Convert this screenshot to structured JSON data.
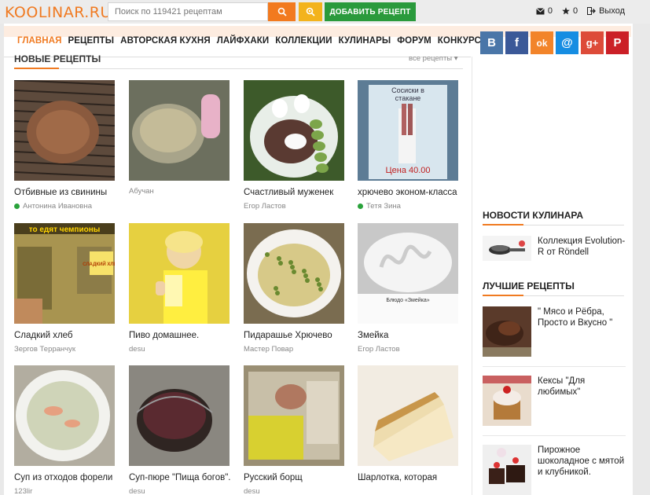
{
  "header": {
    "logo": "KOOLINAR.RU",
    "search_placeholder": "Поиск по 119421 рецептам",
    "add_recipe": "ДОБАВИТЬ РЕЦЕПТ",
    "messages_count": "0",
    "favorites_count": "0",
    "logout": "Выход"
  },
  "nav": [
    "ГЛАВНАЯ",
    "РЕЦЕПТЫ",
    "АВТОРСКАЯ КУХНЯ",
    "ЛАЙФХАКИ",
    "КОЛЛЕКЦИИ",
    "КУЛИНАРЫ",
    "ФОРУМ",
    "КОНКУРСЫ"
  ],
  "social": {
    "vk": "B",
    "fb": "f",
    "ok": "ok",
    "mail": "@",
    "gplus": "g+",
    "pin": "P"
  },
  "new_recipes": {
    "title": "НОВЫЕ РЕЦЕПТЫ",
    "all_link": "все рецепты ▾",
    "items": [
      {
        "title": "Отбивные из свинины",
        "author": "Антонина Ивановна",
        "online": true,
        "color": "#7a4f35"
      },
      {
        "title": "",
        "author": "Абучан",
        "online": false,
        "color": "#8c8a72"
      },
      {
        "title": "Счастливый муженек",
        "author": "Егор Ластов",
        "online": false,
        "color": "#4f6b33"
      },
      {
        "title": "хрючево эконом-класса",
        "author": "Тетя Зина",
        "online": true,
        "color": "#6d8aa4"
      },
      {
        "title": "Сладкий хлеб",
        "author": "Зергов Терранчук",
        "online": false,
        "color": "#7a6a2c"
      },
      {
        "title": "Пиво домашнее.",
        "author": "desu",
        "online": false,
        "color": "#d6c240"
      },
      {
        "title": "Пидарашье Хрючево",
        "author": "Мастер Повар",
        "online": false,
        "color": "#a59a6a"
      },
      {
        "title": "Змейка",
        "author": "Егор Ластов",
        "online": false,
        "color": "#dcdcdc"
      },
      {
        "title": "Суп из отходов форели",
        "author": "123lir",
        "online": false,
        "color": "#9aa08c"
      },
      {
        "title": "Суп-пюре \"Пища богов\".",
        "author": "desu",
        "online": false,
        "color": "#4e3a36"
      },
      {
        "title": "Русский борщ",
        "author": "desu",
        "online": false,
        "color": "#8e8068"
      },
      {
        "title": "Шарлотка, которая",
        "author": "",
        "online": false,
        "color": "#d9c08a"
      }
    ]
  },
  "image_texts": {
    "img4_line1": "Сосиски в",
    "img4_line2": "стакане",
    "img4_price": "Цена 40.00",
    "img5_caption": "то едят чемпионы",
    "img5_sign": "СЛАДКИЙ ХЛЕБ",
    "img8_caption": "Блюдо «Змейка»"
  },
  "sidebar": {
    "news_title": "НОВОСТИ КУЛИНАРА",
    "news": [
      {
        "text": "Коллекция Evolution-R от Röndell"
      }
    ],
    "best_title": "ЛУЧШИЕ РЕЦЕПТЫ",
    "best": [
      {
        "text": "\" Мясо и Рёбра, Просто и Вкусно \""
      },
      {
        "text": "Кексы \"Для любимых\""
      },
      {
        "text": "Пирожное шоколадное с мятой и клубникой."
      }
    ]
  },
  "colors": {
    "accent": "#f07a21",
    "add_button": "#2a9a3c",
    "search_button": "#f27a1f",
    "advanced_button": "#f3b31c"
  }
}
